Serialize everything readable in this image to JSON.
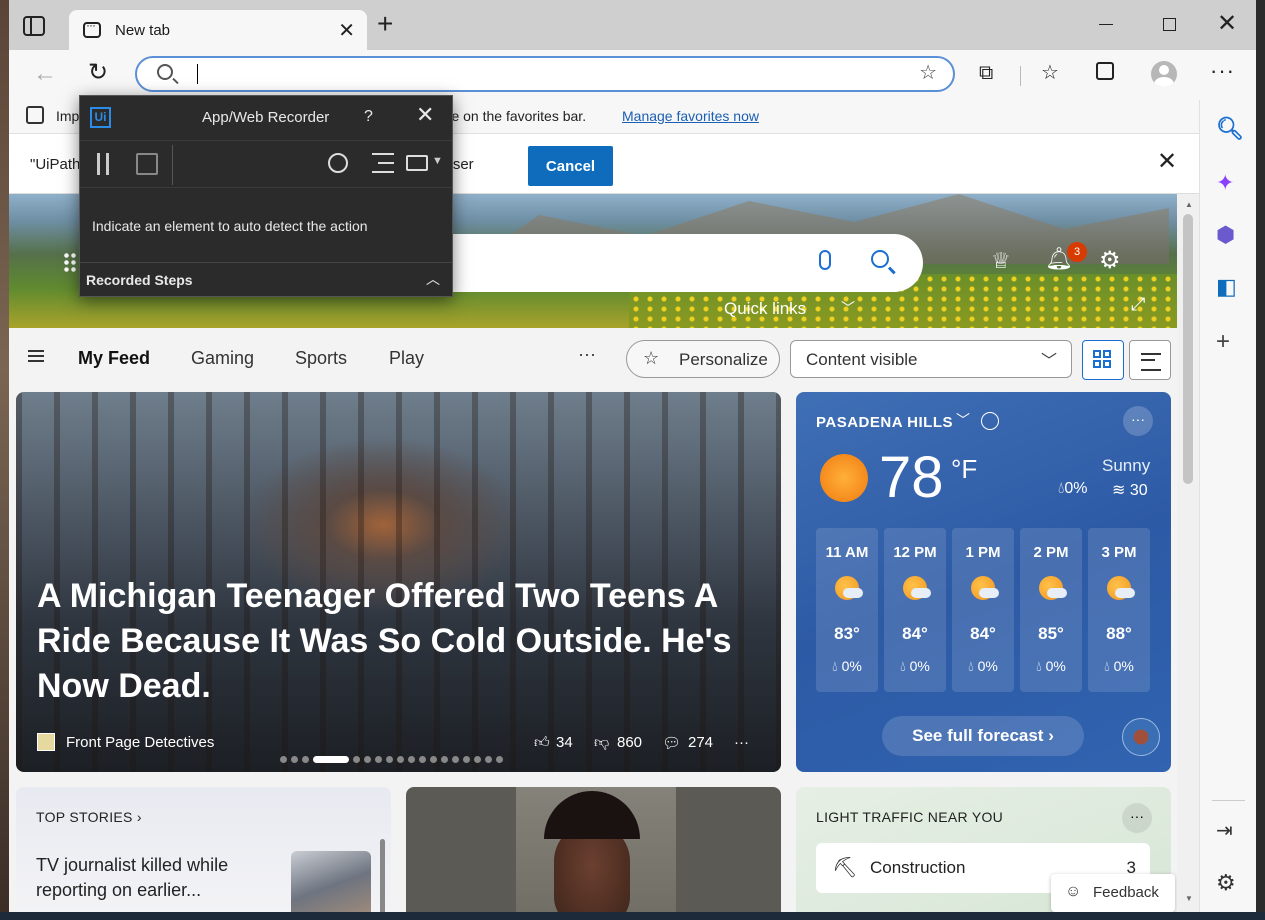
{
  "browser": {
    "tab_title": "New tab",
    "address_value": "",
    "favorites_bar": {
      "import_label": "Imp",
      "message": "ere on the favorites bar.",
      "link": "Manage favorites now"
    },
    "infobar": {
      "left_text": "\"UiPath",
      "right_text": "wser",
      "cancel_label": "Cancel"
    }
  },
  "recorder": {
    "logo_text": "Ui",
    "title": "App/Web Recorder",
    "help": "?",
    "message": "Indicate an element to auto detect the action",
    "steps_label": "Recorded Steps"
  },
  "newtab": {
    "notification_count": "3",
    "quick_links": "Quick links",
    "feed_nav": {
      "items": [
        "My Feed",
        "Gaming",
        "Sports",
        "Play"
      ],
      "more": "···",
      "personalize": "Personalize",
      "content_select": "Content visible"
    },
    "hero_article": {
      "headline": "A Michigan Teenager Offered Two Teens A Ride Because It Was So Cold Outside. He's Now Dead.",
      "source": "Front Page Detectives",
      "likes": "34",
      "dislikes": "860",
      "comments": "274",
      "more": "···",
      "carousel_total": 18,
      "carousel_active": 3
    },
    "weather": {
      "location": "PASADENA HILLS",
      "more": "···",
      "temp": "78",
      "unit": "°F",
      "condition": "Sunny",
      "precip": "0%",
      "aqi": "30",
      "hourly": [
        {
          "time": "11 AM",
          "temp": "83°",
          "precip": "0%"
        },
        {
          "time": "12 PM",
          "temp": "84°",
          "precip": "0%"
        },
        {
          "time": "1 PM",
          "temp": "84°",
          "precip": "0%"
        },
        {
          "time": "2 PM",
          "temp": "85°",
          "precip": "0%"
        },
        {
          "time": "3 PM",
          "temp": "88°",
          "precip": "0%"
        }
      ],
      "forecast_button": "See full forecast ›"
    },
    "top_stories": {
      "heading": "TOP STORIES",
      "headline": "TV journalist killed while reporting on earlier..."
    },
    "traffic": {
      "heading": "LIGHT TRAFFIC NEAR YOU",
      "more": "···",
      "row_label": "Construction",
      "row_count": "3"
    },
    "feedback": "Feedback"
  }
}
